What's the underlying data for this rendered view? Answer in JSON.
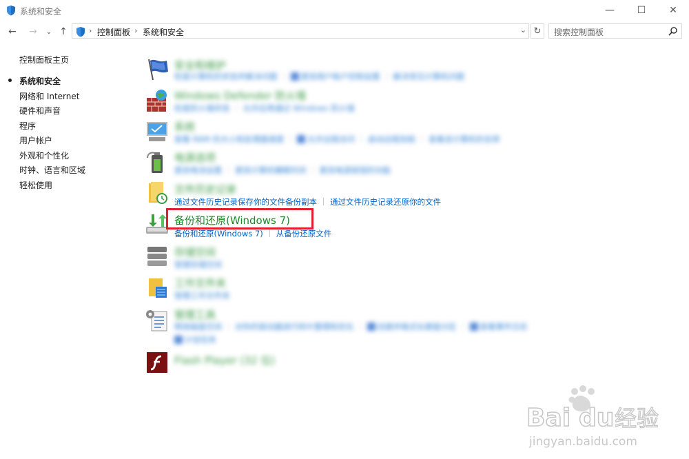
{
  "window": {
    "title": "系统和安全",
    "controls": {
      "minimize": "—",
      "maximize": "☐",
      "close": "✕"
    }
  },
  "nav": {
    "back": "←",
    "forward": "→",
    "recent": "⌄",
    "up": "↑",
    "breadcrumbs": [
      "控制面板",
      "系统和安全"
    ],
    "refresh": "↻",
    "search_placeholder": "搜索控制面板"
  },
  "sidebar": {
    "items": [
      {
        "label": "控制面板主页",
        "active": false
      },
      {
        "label": "系统和安全",
        "active": true
      },
      {
        "label": "网络和 Internet",
        "active": false
      },
      {
        "label": "硬件和声音",
        "active": false
      },
      {
        "label": "程序",
        "active": false
      },
      {
        "label": "用户帐户",
        "active": false
      },
      {
        "label": "外观和个性化",
        "active": false
      },
      {
        "label": "时钟、语言和区域",
        "active": false
      },
      {
        "label": "轻松使用",
        "active": false
      }
    ]
  },
  "categories": [
    {
      "icon": "security-flag-icon",
      "title": "安全和维护",
      "blurred": true,
      "links": [
        "检查计算机的状态并解决问题",
        "更改用户帐户控制设置",
        "解决常见计算机问题"
      ]
    },
    {
      "icon": "firewall-icon",
      "title": "Windows Defender 防火墙",
      "blurred": true,
      "links": [
        "检查防火墙状态",
        "允许应用通过 Windows 防火墙"
      ]
    },
    {
      "icon": "system-monitor-icon",
      "title": "系统",
      "blurred": true,
      "links": [
        "查看 RAM 的大小和处理器速度",
        "允许远程访问",
        "启动远程协助",
        "查看该计算机的名称"
      ]
    },
    {
      "icon": "power-options-icon",
      "title": "电源选项",
      "blurred": true,
      "links": [
        "更改电池设置",
        "更改计算机睡眠时间",
        "更改电源按钮的功能"
      ]
    },
    {
      "icon": "file-history-icon",
      "title": "文件历史记录",
      "blurred": true,
      "links_blurred": false,
      "links": [
        "通过文件历史记录保存你的文件备份副本",
        "通过文件历史记录还原你的文件"
      ]
    },
    {
      "icon": "backup-restore-icon",
      "title": "备份和还原(Windows 7)",
      "blurred": false,
      "highlighted": true,
      "links": [
        "备份和还原(Windows 7)",
        "从备份还原文件"
      ]
    },
    {
      "icon": "storage-spaces-icon",
      "title": "存储空间",
      "blurred": true,
      "links": [
        "管理存储空间"
      ]
    },
    {
      "icon": "work-folders-icon",
      "title": "工作文件夹",
      "blurred": true,
      "links": [
        "管理工作文件夹"
      ]
    },
    {
      "icon": "admin-tools-icon",
      "title": "管理工具",
      "blurred": true,
      "links": [
        "释放磁盘空间",
        "对你的驱动器进行碎片整理和优化",
        "创建并格式化硬盘分区",
        "查看事件日志",
        "计划任务"
      ]
    },
    {
      "icon": "flash-player-icon",
      "title": "Flash Player (32 位)",
      "blurred": true,
      "links": []
    }
  ],
  "watermark": {
    "brand": "Bai",
    "brand2": "du",
    "suffix": "经验",
    "url": "jingyan.baidu.com"
  },
  "colors": {
    "link": "#0066cc",
    "category_title": "#1c8a2a",
    "highlight": "#e02030"
  }
}
